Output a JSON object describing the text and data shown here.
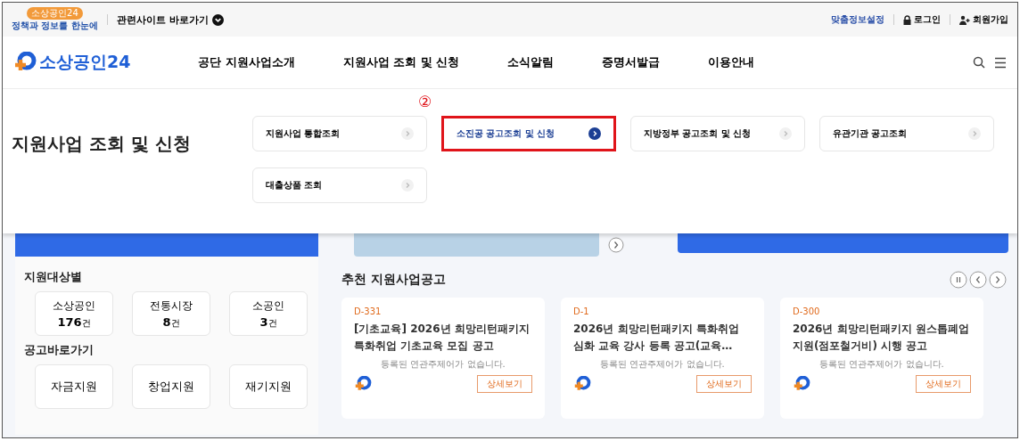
{
  "utility_bar": {
    "badge": "소상공인24",
    "tagline": "정책과 정보를 한눈에",
    "related_sites": "관련사이트 바로가기",
    "links": [
      {
        "kind": "link",
        "label": "맞춤정보설정"
      },
      {
        "kind": "login",
        "label": "로그인"
      },
      {
        "kind": "signup",
        "label": "회원가입"
      }
    ]
  },
  "nav": {
    "logo": "소상공인24",
    "items": [
      "공단 지원사업소개",
      "지원사업 조회 및 신청",
      "소식알림",
      "증명서발급",
      "이용안내"
    ]
  },
  "dropdown": {
    "title": "지원사업 조회 및 신청",
    "annotation": "②",
    "items": [
      {
        "label": "지원사업 통합조회",
        "selected": false,
        "marked": false
      },
      {
        "label": "소진공 공고조회 및 신청",
        "selected": true,
        "marked": true
      },
      {
        "label": "지방정부 공고조회 및 신청",
        "selected": false,
        "marked": false
      },
      {
        "label": "유관기관 공고조회",
        "selected": false,
        "marked": false
      },
      {
        "label": "대출상품 조회",
        "selected": false,
        "marked": false
      }
    ]
  },
  "targets": {
    "heading": "지원대상별",
    "items": [
      {
        "label": "소상공인",
        "count": "176",
        "unit": "건"
      },
      {
        "label": "전통시장",
        "count": "8",
        "unit": "건"
      },
      {
        "label": "소공인",
        "count": "3",
        "unit": "건"
      }
    ]
  },
  "shortcuts": {
    "heading": "공고바로가기",
    "items": [
      "자금지원",
      "창업지원",
      "재기지원"
    ]
  },
  "recommended": {
    "heading": "추천 지원사업공고",
    "cards": [
      {
        "dday": "D-331",
        "title": "[기초교육] 2026년 희망리턴패키지 특화취업 기초교육 모집 공고",
        "note": "등록된 연관주제어가 없습니다.",
        "button": "상세보기"
      },
      {
        "dday": "D-1",
        "title": "2026년 희망리턴패키지 특화취업 심화 교육 강사 등록 공고(교육…",
        "note": "등록된 연관주제어가 없습니다.",
        "button": "상세보기"
      },
      {
        "dday": "D-300",
        "title": "2026년 희망리턴패키지 원스톱폐업 지원(점포철거비) 시행 공고",
        "note": "등록된 연관주제어가 없습니다.",
        "button": "상세보기"
      }
    ]
  }
}
